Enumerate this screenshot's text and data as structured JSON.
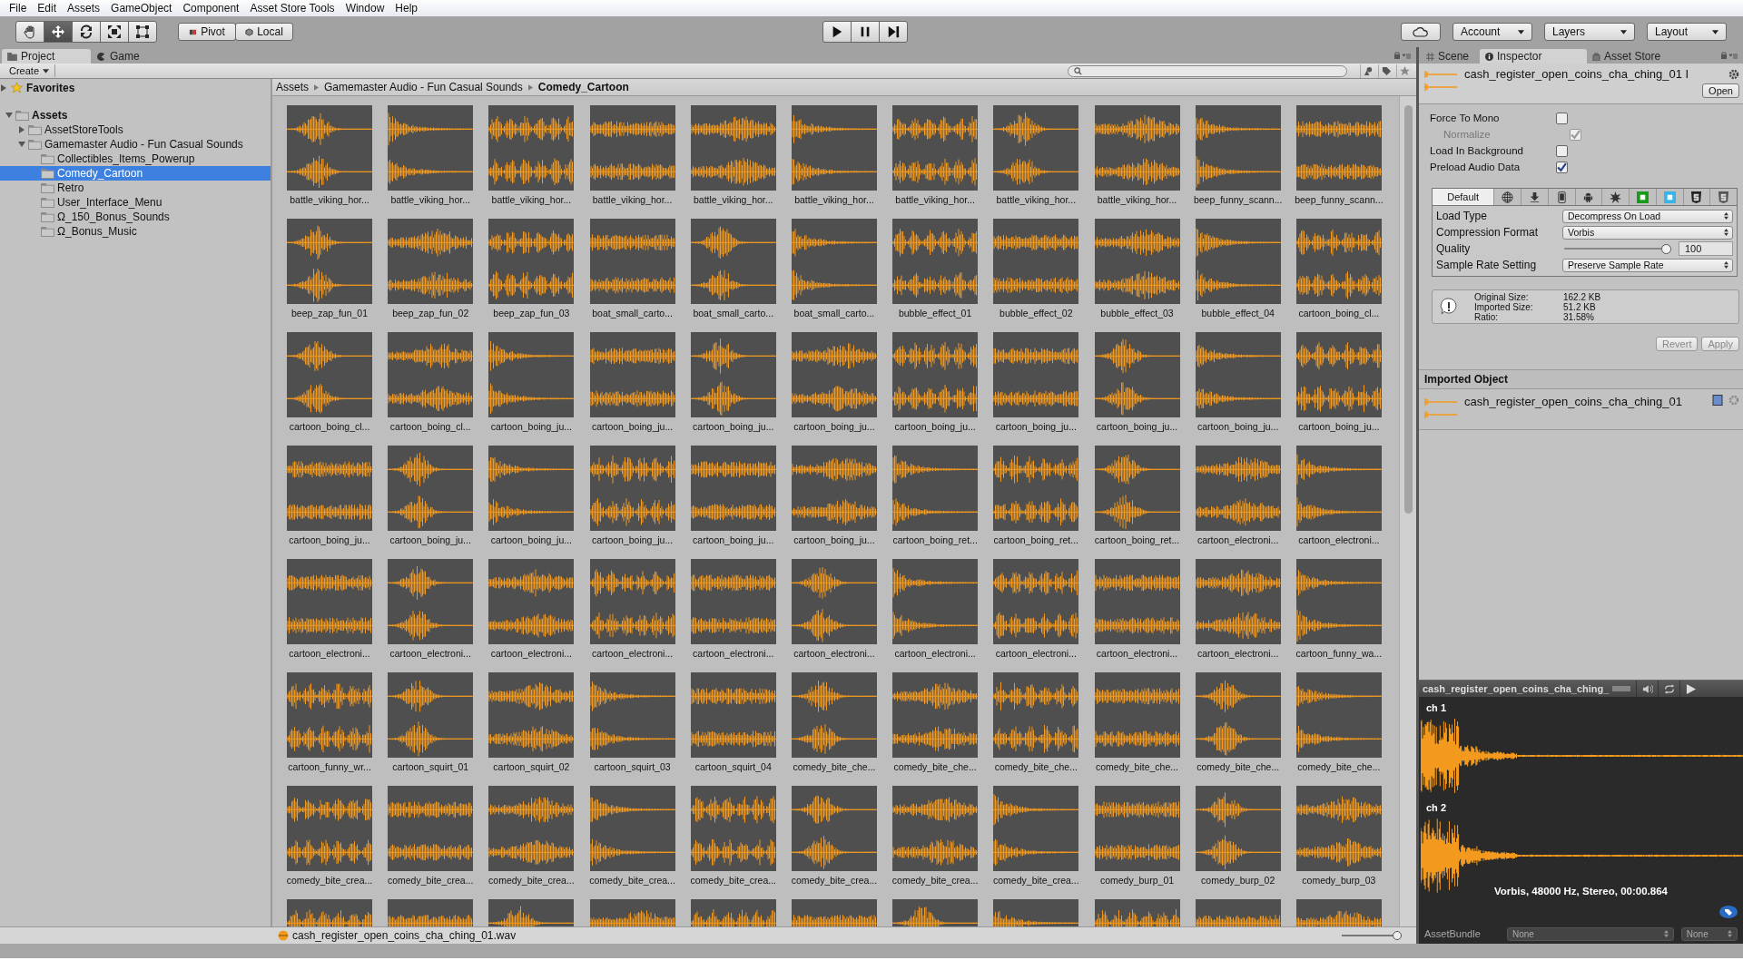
{
  "menu": [
    "File",
    "Edit",
    "Assets",
    "GameObject",
    "Component",
    "Asset Store Tools",
    "Window",
    "Help"
  ],
  "toolbar": {
    "tools": [
      {
        "kind": "hand",
        "selected": false
      },
      {
        "kind": "move",
        "selected": true
      },
      {
        "kind": "rotate",
        "selected": false
      },
      {
        "kind": "scale",
        "selected": false
      },
      {
        "kind": "rect",
        "selected": false
      }
    ],
    "pivot": "Pivot",
    "local": "Local",
    "account": "Account",
    "layers": "Layers",
    "layout": "Layout"
  },
  "project_tabs": [
    {
      "label": "Project",
      "kind": "folder",
      "selected": true
    },
    {
      "label": "Game",
      "kind": "game",
      "selected": false
    }
  ],
  "create": "Create",
  "favorites": "Favorites",
  "tree": [
    {
      "label": "Assets",
      "expanded": true,
      "selected": false,
      "children": [
        {
          "label": "AssetStoreTools",
          "expanded": false,
          "selected": false
        },
        {
          "label": "Gamemaster Audio - Fun Casual Sounds",
          "expanded": true,
          "selected": false,
          "children": [
            {
              "label": "Collectibles_Items_Powerup",
              "selected": false
            },
            {
              "label": "Comedy_Cartoon",
              "selected": true
            },
            {
              "label": "Retro",
              "selected": false
            },
            {
              "label": "User_Interface_Menu",
              "selected": false
            },
            {
              "label": "Ω_150_Bonus_Sounds",
              "selected": false
            },
            {
              "label": "Ω_Bonus_Music",
              "selected": false
            }
          ]
        }
      ]
    }
  ],
  "breadcrumb": [
    "Assets",
    "Gamemaster Audio - Fun Casual Sounds",
    "Comedy_Cartoon"
  ],
  "clips": [
    {
      "kind": "clip",
      "label": "battle_viking_hor..."
    },
    {
      "kind": "clip",
      "label": "battle_viking_hor..."
    },
    {
      "kind": "clip",
      "label": "battle_viking_hor..."
    },
    {
      "kind": "clip",
      "label": "battle_viking_hor..."
    },
    {
      "kind": "clip",
      "label": "battle_viking_hor..."
    },
    {
      "kind": "clip",
      "label": "battle_viking_hor..."
    },
    {
      "kind": "clip",
      "label": "battle_viking_hor..."
    },
    {
      "kind": "clip",
      "label": "battle_viking_hor..."
    },
    {
      "kind": "clip",
      "label": "battle_viking_hor..."
    },
    {
      "kind": "clip",
      "label": "beep_funny_scann..."
    },
    {
      "kind": "clip",
      "label": "beep_funny_scann..."
    },
    {
      "kind": "clip",
      "label": "beep_zap_fun_01"
    },
    {
      "kind": "clip",
      "label": "beep_zap_fun_02"
    },
    {
      "kind": "clip",
      "label": "beep_zap_fun_03"
    },
    {
      "kind": "clip",
      "label": "boat_small_carto..."
    },
    {
      "kind": "clip",
      "label": "boat_small_carto..."
    },
    {
      "kind": "clip",
      "label": "boat_small_carto..."
    },
    {
      "kind": "clip",
      "label": "bubble_effect_01"
    },
    {
      "kind": "clip",
      "label": "bubble_effect_02"
    },
    {
      "kind": "clip",
      "label": "bubble_effect_03"
    },
    {
      "kind": "clip",
      "label": "bubble_effect_04"
    },
    {
      "kind": "clip",
      "label": "cartoon_boing_cl..."
    },
    {
      "kind": "clip",
      "label": "cartoon_boing_cl..."
    },
    {
      "kind": "clip",
      "label": "cartoon_boing_cl..."
    },
    {
      "kind": "clip",
      "label": "cartoon_boing_ju..."
    },
    {
      "kind": "clip",
      "label": "cartoon_boing_ju..."
    },
    {
      "kind": "clip",
      "label": "cartoon_boing_ju..."
    },
    {
      "kind": "clip",
      "label": "cartoon_boing_ju..."
    },
    {
      "kind": "clip",
      "label": "cartoon_boing_ju..."
    },
    {
      "kind": "clip",
      "label": "cartoon_boing_ju..."
    },
    {
      "kind": "clip",
      "label": "cartoon_boing_ju..."
    },
    {
      "kind": "clip",
      "label": "cartoon_boing_ju..."
    },
    {
      "kind": "clip",
      "label": "cartoon_boing_ju..."
    },
    {
      "kind": "clip",
      "label": "cartoon_boing_ju..."
    },
    {
      "kind": "clip",
      "label": "cartoon_boing_ju..."
    },
    {
      "kind": "clip",
      "label": "cartoon_boing_ju..."
    },
    {
      "kind": "clip",
      "label": "cartoon_boing_ju..."
    },
    {
      "kind": "clip",
      "label": "cartoon_boing_ju..."
    },
    {
      "kind": "clip",
      "label": "cartoon_boing_ju..."
    },
    {
      "kind": "clip",
      "label": "cartoon_boing_ret..."
    },
    {
      "kind": "clip",
      "label": "cartoon_boing_ret..."
    },
    {
      "kind": "clip",
      "label": "cartoon_boing_ret..."
    },
    {
      "kind": "clip",
      "label": "cartoon_electroni..."
    },
    {
      "kind": "clip",
      "label": "cartoon_electroni..."
    },
    {
      "kind": "clip",
      "label": "cartoon_electroni..."
    },
    {
      "kind": "clip",
      "label": "cartoon_electroni..."
    },
    {
      "kind": "clip",
      "label": "cartoon_electroni..."
    },
    {
      "kind": "clip",
      "label": "cartoon_electroni..."
    },
    {
      "kind": "clip",
      "label": "cartoon_electroni..."
    },
    {
      "kind": "clip",
      "label": "cartoon_electroni..."
    },
    {
      "kind": "clip",
      "label": "cartoon_electroni..."
    },
    {
      "kind": "clip",
      "label": "cartoon_electroni..."
    },
    {
      "kind": "clip",
      "label": "cartoon_electroni..."
    },
    {
      "kind": "clip",
      "label": "cartoon_electroni..."
    },
    {
      "kind": "clip",
      "label": "cartoon_funny_wa..."
    },
    {
      "kind": "clip",
      "label": "cartoon_funny_wr..."
    },
    {
      "kind": "clip",
      "label": "cartoon_squirt_01"
    },
    {
      "kind": "clip",
      "label": "cartoon_squirt_02"
    },
    {
      "kind": "clip",
      "label": "cartoon_squirt_03"
    },
    {
      "kind": "clip",
      "label": "cartoon_squirt_04"
    },
    {
      "kind": "clip",
      "label": "comedy_bite_che..."
    },
    {
      "kind": "clip",
      "label": "comedy_bite_che..."
    },
    {
      "kind": "clip",
      "label": "comedy_bite_che..."
    },
    {
      "kind": "clip",
      "label": "comedy_bite_che..."
    },
    {
      "kind": "clip",
      "label": "comedy_bite_che..."
    },
    {
      "kind": "clip",
      "label": "comedy_bite_che..."
    },
    {
      "kind": "clip",
      "label": "comedy_bite_crea..."
    },
    {
      "kind": "clip",
      "label": "comedy_bite_crea..."
    },
    {
      "kind": "clip",
      "label": "comedy_bite_crea..."
    },
    {
      "kind": "clip",
      "label": "comedy_bite_crea..."
    },
    {
      "kind": "clip",
      "label": "comedy_bite_crea..."
    },
    {
      "kind": "clip",
      "label": "comedy_bite_crea..."
    },
    {
      "kind": "clip",
      "label": "comedy_bite_crea..."
    },
    {
      "kind": "clip",
      "label": "comedy_bite_crea..."
    },
    {
      "kind": "clip",
      "label": "comedy_burp_01"
    },
    {
      "kind": "clip",
      "label": "comedy_burp_02"
    },
    {
      "kind": "clip",
      "label": "comedy_burp_03"
    },
    {
      "kind": "cut"
    },
    {
      "kind": "cut"
    },
    {
      "kind": "cut"
    },
    {
      "kind": "cut"
    },
    {
      "kind": "cut"
    },
    {
      "kind": "cut"
    },
    {
      "kind": "cut"
    },
    {
      "kind": "cut"
    },
    {
      "kind": "cut"
    },
    {
      "kind": "cut"
    },
    {
      "kind": "cut"
    }
  ],
  "status_bar": {
    "file": "cash_register_open_coins_cha_ching_01.wav",
    "zoom": {
      "level": 1.0
    }
  },
  "inspector_tabs": [
    {
      "label": "Scene",
      "kind": "grid",
      "selected": false
    },
    {
      "label": "Inspector",
      "kind": "info",
      "selected": true
    },
    {
      "label": "Asset Store",
      "kind": "bag",
      "selected": false
    }
  ],
  "inspector": {
    "title": "cash_register_open_coins_cha_ching_01 I",
    "open": "Open",
    "options": [
      {
        "label": "Force To Mono",
        "checked": false,
        "disabled": false,
        "children": [
          {
            "label": "Normalize",
            "checked": true,
            "disabled": true
          }
        ]
      },
      {
        "label": "Load In Background",
        "checked": false,
        "disabled": false
      },
      {
        "label": "Preload Audio Data",
        "checked": true,
        "disabled": false
      }
    ],
    "platforms": [
      {
        "kind": "default",
        "label": "Default",
        "selected": true
      },
      {
        "kind": "globe",
        "selected": false
      },
      {
        "kind": "download",
        "selected": false
      },
      {
        "kind": "phone",
        "selected": false
      },
      {
        "kind": "robot",
        "selected": false
      },
      {
        "kind": "burst",
        "selected": false
      },
      {
        "kind": "tile",
        "color": "#1a9a1a",
        "selected": false
      },
      {
        "kind": "tile",
        "color": "#38b4e8",
        "selected": false
      },
      {
        "kind": "shield",
        "color": "#222222",
        "selected": false
      },
      {
        "kind": "shield",
        "color": "#555555",
        "selected": false
      }
    ],
    "settings": [
      {
        "kind": "dropdown",
        "label": "Load Type",
        "value": "Decompress On Load"
      },
      {
        "kind": "dropdown",
        "label": "Compression Format",
        "value": "Vorbis"
      },
      {
        "kind": "slider",
        "label": "Quality",
        "level": 1.0,
        "value": "100"
      },
      {
        "kind": "dropdown",
        "label": "Sample Rate Setting",
        "value": "Preserve Sample Rate"
      }
    ],
    "info": [
      {
        "label": "Original Size:",
        "value": "162.2 KB"
      },
      {
        "label": "Imported Size:",
        "value": "51.2 KB"
      },
      {
        "label": "Ratio:",
        "value": "31.58%"
      }
    ],
    "buttons": [
      {
        "label": "Revert",
        "disabled": true
      },
      {
        "label": "Apply",
        "disabled": true
      }
    ],
    "imported_header": "Imported Object",
    "imported_name": "cash_register_open_coins_cha_ching_01"
  },
  "preview": {
    "title": "cash_register_open_coins_cha_ching_",
    "channels": [
      "ch 1",
      "ch 2"
    ],
    "info": "Vorbis, 48000 Hz, Stereo, 00:00.864",
    "asset_bundle": "AssetBundle",
    "bundle_values": [
      "None",
      "None"
    ]
  }
}
